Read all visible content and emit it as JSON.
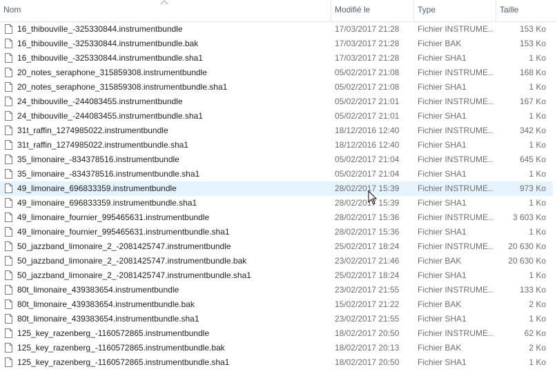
{
  "columns": {
    "name": "Nom",
    "date": "Modifié le",
    "type": "Type",
    "size": "Taille"
  },
  "hovered_row_index": 11,
  "rows": [
    {
      "name": "16_thibouville_-325330844.instrumentbundle",
      "date": "17/03/2017 21:28",
      "type": "Fichier INSTRUME...",
      "size": "153 Ko"
    },
    {
      "name": "16_thibouville_-325330844.instrumentbundle.bak",
      "date": "17/03/2017 21:28",
      "type": "Fichier BAK",
      "size": "153 Ko"
    },
    {
      "name": "16_thibouville_-325330844.instrumentbundle.sha1",
      "date": "17/03/2017 21:28",
      "type": "Fichier SHA1",
      "size": "1 Ko"
    },
    {
      "name": "20_notes_seraphone_315859308.instrumentbundle",
      "date": "05/02/2017 21:08",
      "type": "Fichier INSTRUME...",
      "size": "168 Ko"
    },
    {
      "name": "20_notes_seraphone_315859308.instrumentbundle.sha1",
      "date": "05/02/2017 21:08",
      "type": "Fichier SHA1",
      "size": "1 Ko"
    },
    {
      "name": "24_thibouville_-244083455.instrumentbundle",
      "date": "05/02/2017 21:01",
      "type": "Fichier INSTRUME...",
      "size": "167 Ko"
    },
    {
      "name": "24_thibouville_-244083455.instrumentbundle.sha1",
      "date": "05/02/2017 21:01",
      "type": "Fichier SHA1",
      "size": "1 Ko"
    },
    {
      "name": "31t_raffin_1274985022.instrumentbundle",
      "date": "18/12/2016 12:40",
      "type": "Fichier INSTRUME...",
      "size": "342 Ko"
    },
    {
      "name": "31t_raffin_1274985022.instrumentbundle.sha1",
      "date": "18/12/2016 12:40",
      "type": "Fichier SHA1",
      "size": "1 Ko"
    },
    {
      "name": "35_limonaire_-834378516.instrumentbundle",
      "date": "05/02/2017 21:04",
      "type": "Fichier INSTRUME...",
      "size": "645 Ko"
    },
    {
      "name": "35_limonaire_-834378516.instrumentbundle.sha1",
      "date": "05/02/2017 21:04",
      "type": "Fichier SHA1",
      "size": "1 Ko"
    },
    {
      "name": "49_limonaire_696833359.instrumentbundle",
      "date": "28/02/2017 15:39",
      "type": "Fichier INSTRUME...",
      "size": "973 Ko"
    },
    {
      "name": "49_limonaire_696833359.instrumentbundle.sha1",
      "date": "28/02/2017 15:39",
      "type": "Fichier SHA1",
      "size": "1 Ko"
    },
    {
      "name": "49_limonaire_fournier_995465631.instrumentbundle",
      "date": "28/02/2017 15:36",
      "type": "Fichier INSTRUME...",
      "size": "3 603 Ko"
    },
    {
      "name": "49_limonaire_fournier_995465631.instrumentbundle.sha1",
      "date": "28/02/2017 15:36",
      "type": "Fichier SHA1",
      "size": "1 Ko"
    },
    {
      "name": "50_jazzband_limonaire_2_-2081425747.instrumentbundle",
      "date": "25/02/2017 18:24",
      "type": "Fichier INSTRUME...",
      "size": "20 630 Ko"
    },
    {
      "name": "50_jazzband_limonaire_2_-2081425747.instrumentbundle.bak",
      "date": "23/02/2017 21:46",
      "type": "Fichier BAK",
      "size": "20 630 Ko"
    },
    {
      "name": "50_jazzband_limonaire_2_-2081425747.instrumentbundle.sha1",
      "date": "25/02/2017 18:24",
      "type": "Fichier SHA1",
      "size": "1 Ko"
    },
    {
      "name": "80t_limonaire_439383654.instrumentbundle",
      "date": "23/02/2017 21:55",
      "type": "Fichier INSTRUME...",
      "size": "133 Ko"
    },
    {
      "name": "80t_limonaire_439383654.instrumentbundle.bak",
      "date": "15/02/2017 21:22",
      "type": "Fichier BAK",
      "size": "2 Ko"
    },
    {
      "name": "80t_limonaire_439383654.instrumentbundle.sha1",
      "date": "23/02/2017 21:55",
      "type": "Fichier SHA1",
      "size": "1 Ko"
    },
    {
      "name": "125_key_razenberg_-1160572865.instrumentbundle",
      "date": "18/02/2017 20:50",
      "type": "Fichier INSTRUME...",
      "size": "62 Ko"
    },
    {
      "name": "125_key_razenberg_-1160572865.instrumentbundle.bak",
      "date": "18/02/2017 20:13",
      "type": "Fichier BAK",
      "size": "2 Ko"
    },
    {
      "name": "125_key_razenberg_-1160572865.instrumentbundle.sha1",
      "date": "18/02/2017 20:50",
      "type": "Fichier SHA1",
      "size": "1 Ko"
    }
  ]
}
